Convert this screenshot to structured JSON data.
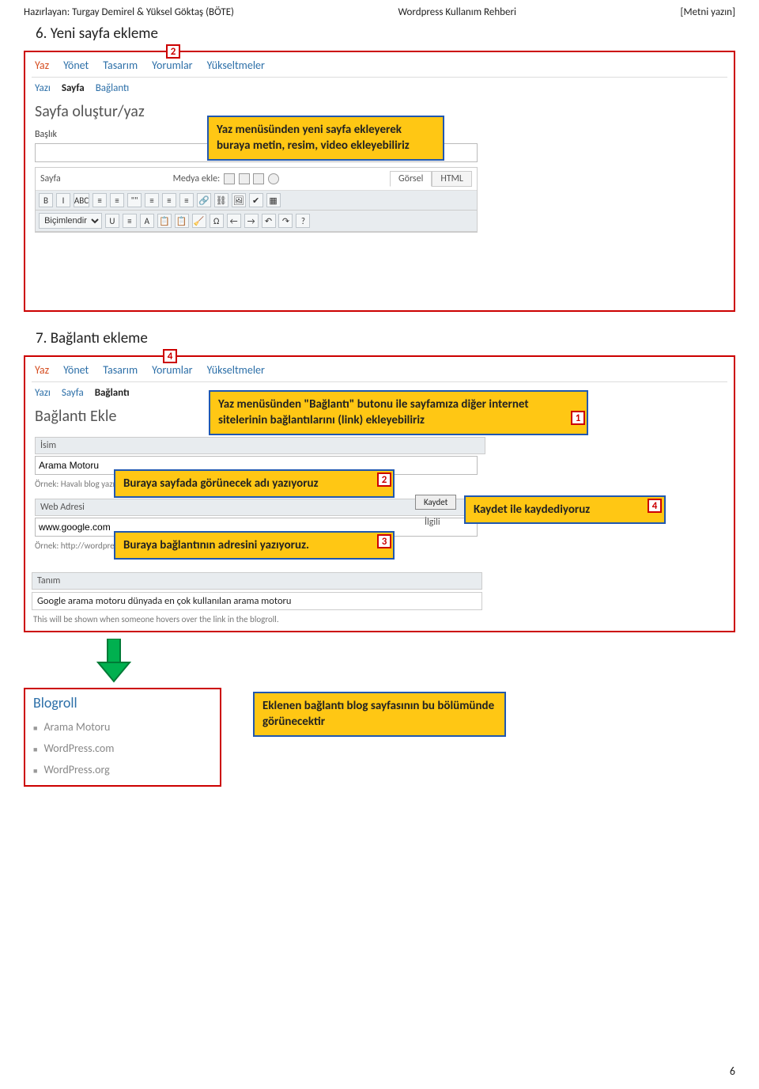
{
  "header": {
    "left": "Hazırlayan: Turgay Demirel & Yüksel Göktaş (BÖTE)",
    "center": "Wordpress Kullanım Rehberi",
    "right": "[Metni yazın]"
  },
  "section6": {
    "title": "6. Yeni sayfa ekleme",
    "badge": "2",
    "tabs": [
      "Yaz",
      "Yönet",
      "Tasarım",
      "Yorumlar",
      "Yükseltmeler"
    ],
    "subtabs": [
      "Yazı",
      "Sayfa",
      "Bağlantı"
    ],
    "wp_title": "Sayfa oluştur/yaz",
    "label_baslik": "Başlık",
    "editor_head_left": "Sayfa",
    "editor_head_medya": "Medya ekle:",
    "editor_tab_gorsel": "Görsel",
    "editor_tab_html": "HTML",
    "tb_row1": [
      "B",
      "I",
      "ABC",
      "≡",
      "≡",
      "\"\"",
      "≡",
      "≡",
      "≡",
      "🔗",
      "⛓",
      "🖼",
      "✔",
      "▦"
    ],
    "tb_row2_label": "Biçimlendir",
    "tb_row2": [
      "U",
      "≡",
      "A",
      "📋",
      "📋",
      "🧹",
      "Ω",
      "←",
      "→",
      "↶",
      "↷",
      "?"
    ],
    "callout": "Yaz menüsünden yeni sayfa ekleyerek buraya metin, resim, video ekleyebiliriz"
  },
  "section7": {
    "title": "7. Bağlantı ekleme",
    "badge": "4",
    "tabs": [
      "Yaz",
      "Yönet",
      "Tasarım",
      "Yorumlar",
      "Yükseltmeler"
    ],
    "subtabs": [
      "Yazı",
      "Sayfa",
      "Bağlantı"
    ],
    "wp_title": "Bağlantı Ekle",
    "isim_head": "İsim",
    "isim_value": "Arama Motoru",
    "isim_hint": "Örnek: Havalı blog yazılımı",
    "web_head": "Web Adresi",
    "web_value": "www.google.com",
    "web_hint": "Örnek: http://wordpress.org/ — http:// koymayı unutmayın",
    "kaydet": "Kaydet",
    "ilgili": "İlgili",
    "tanim_head": "Tanım",
    "tanim_value": "Google arama motoru dünyada en çok kullanılan arama motoru",
    "tanim_hint": "This will be shown when someone hovers over the link in the blogroll.",
    "c_a": "Yaz menüsünden \"Bağlantı\" butonu ile sayfamıza diğer internet sitelerinin bağlantılarını (link) ekleyebiliriz",
    "c_b": "Buraya sayfada görünecek adı yazıyoruz",
    "c_c": "Buraya bağlantının adresini yazıyoruz.",
    "c_d": "Kaydet ile kaydediyoruz",
    "n1": "1",
    "n2": "2",
    "n3": "3",
    "n4": "4"
  },
  "blogroll": {
    "title": "Blogroll",
    "items": [
      "Arama Motoru",
      "WordPress.com",
      "WordPress.org"
    ],
    "callout": "Eklenen bağlantı blog sayfasının bu bölümünde görünecektir"
  },
  "page_number": "6"
}
